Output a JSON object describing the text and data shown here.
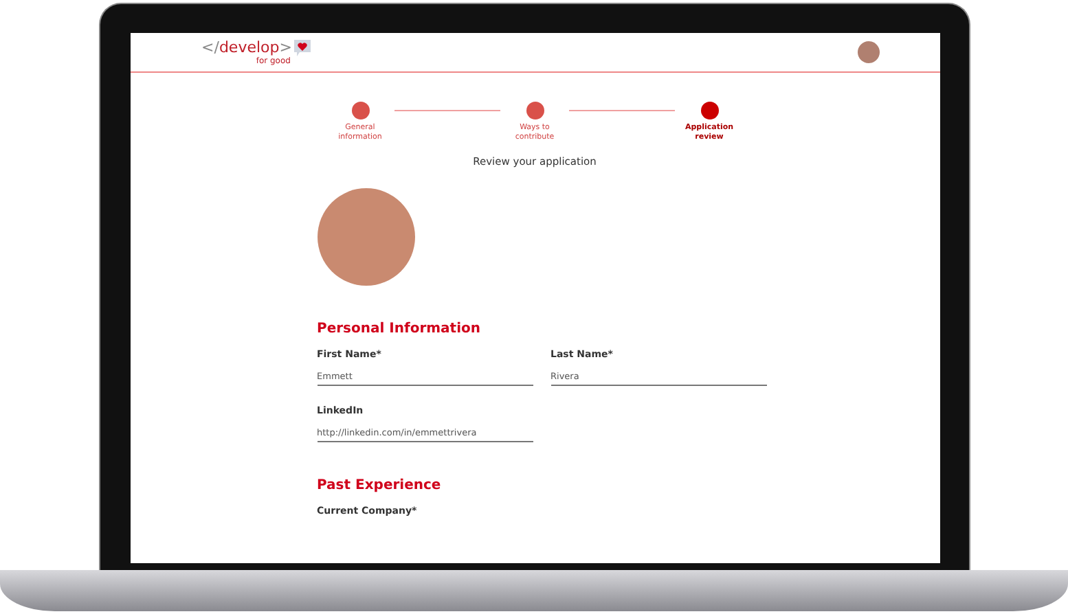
{
  "header": {
    "logo": {
      "code": "</",
      "word": "develop",
      "close": ">",
      "tagline": "for good"
    }
  },
  "steps": [
    {
      "label": "General information",
      "selected": false
    },
    {
      "label": "Ways to contribute",
      "selected": false
    },
    {
      "label": "Application review",
      "selected": true
    }
  ],
  "subtitle": "Review your application",
  "sections": [
    {
      "title": "Personal Information",
      "fields": [
        {
          "label": "First Name*",
          "value": "Emmett"
        },
        {
          "label": "Last Name*",
          "value": "Rivera"
        },
        {
          "label": "LinkedIn",
          "value": "http://linkedin.com/in/emmettrivera"
        }
      ]
    },
    {
      "title": "Past Experience",
      "fields": [
        {
          "label": "Current Company*"
        }
      ]
    }
  ]
}
